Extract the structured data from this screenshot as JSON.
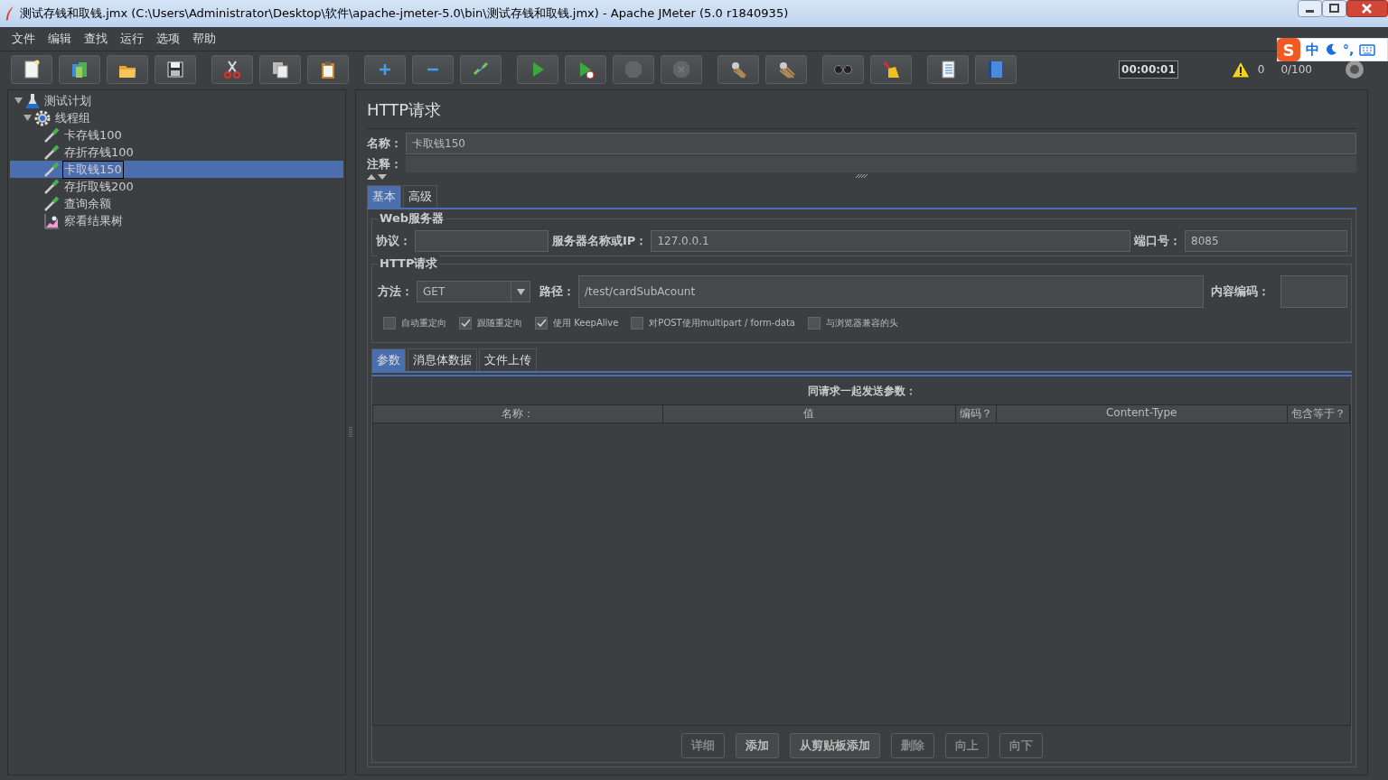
{
  "window": {
    "title": "测试存钱和取钱.jmx (C:\\Users\\Administrator\\Desktop\\软件\\apache-jmeter-5.0\\bin\\测试存钱和取钱.jmx) - Apache JMeter (5.0 r1840935)"
  },
  "menu": [
    "文件",
    "编辑",
    "查找",
    "运行",
    "选项",
    "帮助"
  ],
  "toolbar": [
    [
      {
        "kind": "new",
        "disabled": false
      },
      {
        "kind": "templates",
        "disabled": false
      },
      {
        "kind": "open",
        "disabled": false
      },
      {
        "kind": "save",
        "disabled": false
      }
    ],
    [
      {
        "kind": "cut",
        "disabled": false
      },
      {
        "kind": "copy",
        "disabled": false
      },
      {
        "kind": "paste",
        "disabled": false
      }
    ],
    [
      {
        "kind": "expand",
        "disabled": false
      },
      {
        "kind": "collapse",
        "disabled": false
      },
      {
        "kind": "toggle",
        "disabled": false
      }
    ],
    [
      {
        "kind": "start",
        "disabled": false
      },
      {
        "kind": "start-no-timers",
        "disabled": false
      },
      {
        "kind": "stop",
        "disabled": true
      },
      {
        "kind": "shutdown",
        "disabled": true
      }
    ],
    [
      {
        "kind": "clear",
        "disabled": false
      },
      {
        "kind": "clear-all",
        "disabled": false
      }
    ],
    [
      {
        "kind": "search",
        "disabled": false
      },
      {
        "kind": "reset-search",
        "disabled": false
      }
    ],
    [
      {
        "kind": "function-helper",
        "disabled": false
      },
      {
        "kind": "help",
        "disabled": false
      }
    ]
  ],
  "status": {
    "timer": "00:00:01",
    "warnings": "0",
    "threads": "0/100"
  },
  "ime": {
    "logo": "S",
    "mode": "中",
    "punctuation": "°,"
  },
  "tree": [
    {
      "label": "测试计划",
      "kind": "plan",
      "selected": false,
      "expanded": true,
      "children": [
        {
          "label": "线程组",
          "kind": "thread-group",
          "selected": false,
          "expanded": true,
          "children": [
            {
              "label": "卡存钱100",
              "kind": "sampler",
              "selected": false
            },
            {
              "label": "存折存钱100",
              "kind": "sampler",
              "selected": false
            },
            {
              "label": "卡取钱150",
              "kind": "sampler",
              "selected": true
            },
            {
              "label": "存折取钱200",
              "kind": "sampler",
              "selected": false
            },
            {
              "label": "查询余额",
              "kind": "sampler",
              "selected": false
            },
            {
              "label": "察看结果树",
              "kind": "listener",
              "selected": false
            }
          ]
        }
      ]
    }
  ],
  "editor": {
    "title": "HTTP请求",
    "name_label": "名称：",
    "name": "卡取钱150",
    "comment_label": "注释：",
    "tabs": [
      {
        "label": "基本",
        "selected": true
      },
      {
        "label": "高级",
        "selected": false
      }
    ],
    "web_server": {
      "legend": "Web服务器",
      "protocol_label": "协议：",
      "server_label": "服务器名称或IP：",
      "server": "127.0.0.1",
      "port_label": "端口号：",
      "port": "8085"
    },
    "http_request": {
      "legend": "HTTP请求",
      "method_label": "方法：",
      "method": "GET",
      "path_label": "路径：",
      "path": "/test/cardSubAcount",
      "encoding_label": "内容编码：",
      "options": [
        {
          "label": "自动重定向",
          "checked": false
        },
        {
          "label": "跟随重定向",
          "checked": true
        },
        {
          "label": "使用 KeepAlive",
          "checked": true
        },
        {
          "label": "对POST使用multipart / form-data",
          "checked": false
        },
        {
          "label": "与浏览器兼容的头",
          "checked": false
        }
      ]
    },
    "sub_tabs": [
      {
        "label": "参数",
        "selected": true
      },
      {
        "label": "消息体数据",
        "selected": false
      },
      {
        "label": "文件上传",
        "selected": false
      }
    ],
    "params": {
      "caption": "同请求一起发送参数：",
      "columns": [
        "名称：",
        "值",
        "编码？",
        "Content-Type",
        "包含等于？"
      ]
    },
    "buttons": [
      {
        "label": "详细",
        "disabled": true
      },
      {
        "label": "添加",
        "disabled": false
      },
      {
        "label": "从剪贴板添加",
        "disabled": false
      },
      {
        "label": "删除",
        "disabled": true
      },
      {
        "label": "向上",
        "disabled": true
      },
      {
        "label": "向下",
        "disabled": true
      }
    ]
  }
}
